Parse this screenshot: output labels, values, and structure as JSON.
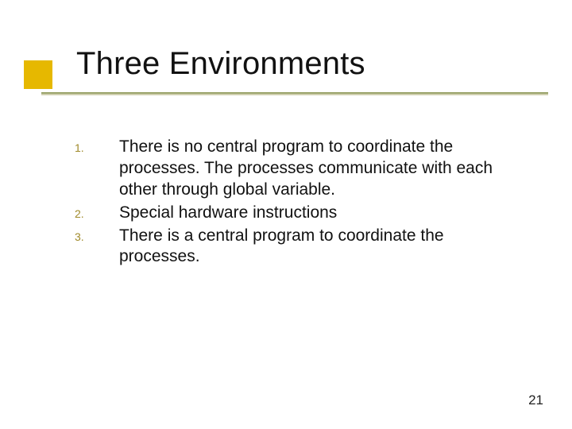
{
  "slide": {
    "title": "Three Environments",
    "items": [
      {
        "marker": "1.",
        "text": "There is no central program to coordinate the processes. The processes communicate with each other through global variable."
      },
      {
        "marker": "2.",
        "text": "Special hardware instructions"
      },
      {
        "marker": "3.",
        "text": "There is a central program to coordinate the processes."
      }
    ],
    "page_number": "21"
  }
}
